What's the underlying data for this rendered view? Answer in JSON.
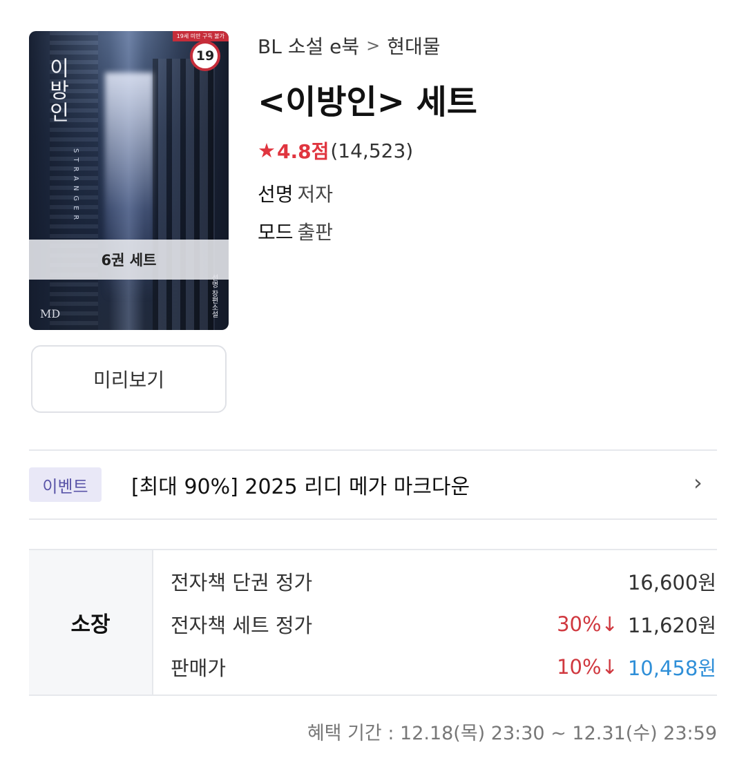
{
  "cover": {
    "age_notice": "19세 미만 구독 불가",
    "age_rating": "19",
    "vertical_title": "이방인",
    "vertical_subtitle": "STRANGER",
    "set_band": "6권 세트",
    "cover_author": "선명 장편소설",
    "logo": "MD"
  },
  "preview_button": "미리보기",
  "breadcrumb": {
    "category": "BL 소설 e북",
    "sep": ">",
    "sub": "현대물"
  },
  "title": "<이방인> 세트",
  "rating": {
    "star": "★",
    "score": "4.8점",
    "count": "(14,523)"
  },
  "author": {
    "name": "선명",
    "role": "저자"
  },
  "publisher": {
    "name": "모드",
    "role": "출판"
  },
  "event": {
    "badge": "이벤트",
    "title": "[최대 90%] 2025 리디 메가 마크다운",
    "arrow": "›"
  },
  "price": {
    "label": "소장",
    "rows": [
      {
        "name": "전자책 단권 정가",
        "discount": "",
        "amount": "16,600원"
      },
      {
        "name": "전자책 세트 정가",
        "discount": "30%↓",
        "amount": "11,620원"
      },
      {
        "name": "판매가",
        "discount": "10%↓",
        "amount": "10,458원"
      }
    ]
  },
  "period": "혜택 기간 : 12.18(목) 23:30 ~ 12.31(수) 23:59"
}
